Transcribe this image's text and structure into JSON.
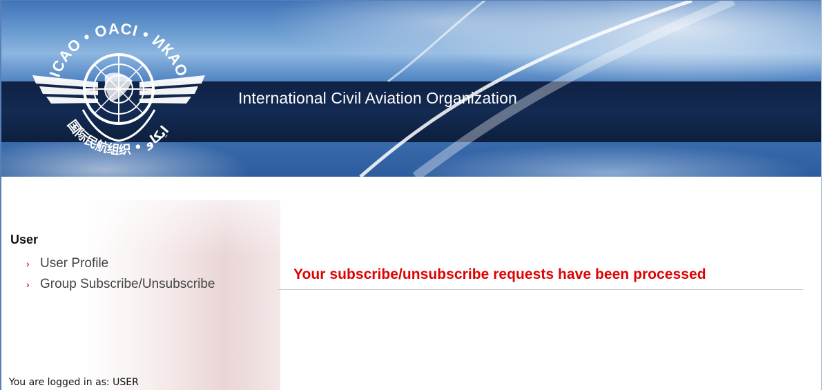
{
  "banner": {
    "logo_text_top": "ICAO • OACI • ИКАО",
    "logo_text_bottom": "国际民航组织 • ايكاو",
    "title": "International Civil Aviation Organization"
  },
  "sidebar": {
    "heading": "User",
    "items": [
      {
        "label": "User Profile",
        "icon": "chevron-right-icon"
      },
      {
        "label": "Group Subscribe/Unsubscribe",
        "icon": "chevron-right-icon"
      }
    ],
    "logged_in_text": "You are logged in as: USER"
  },
  "main": {
    "message": "Your subscribe/unsubscribe requests have been processed"
  },
  "colors": {
    "message": "#e00000",
    "chevron": "#c0392b",
    "banner_band": "#132a52"
  }
}
